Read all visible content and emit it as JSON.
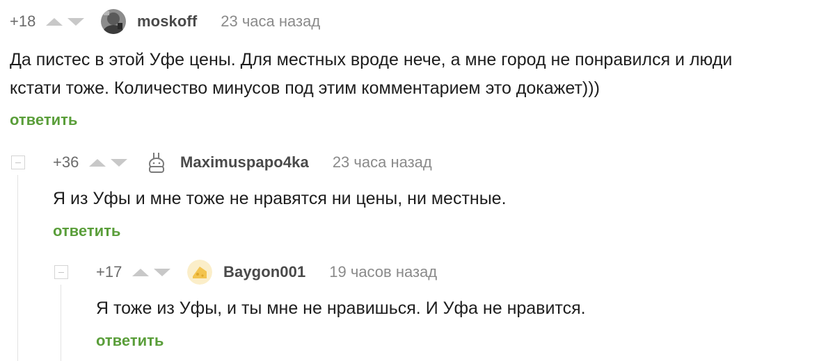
{
  "comments": [
    {
      "rating": "+18",
      "username": "moskoff",
      "time": "23 часа назад",
      "text_lines": [
        "Да пистес в этой Уфе цены. Для местных вроде нече, а мне город не понравился и люди",
        "кстати тоже. Количество минусов под этим комментарием это докажет)))"
      ],
      "reply_label": "ответить",
      "avatar_icon": "photo-avatar"
    },
    {
      "rating": "+36",
      "username": "Maximuspapo4ka",
      "time": "23 часа назад",
      "text_lines": [
        "Я из Уфы и мне тоже не нравятся ни цены, ни местные."
      ],
      "reply_label": "ответить",
      "avatar_icon": "bunny-icon"
    },
    {
      "rating": "+17",
      "username": "Baygon001",
      "time": "19 часов назад",
      "text_lines": [
        "Я тоже из Уфы, и ты мне не нравишься. И Уфа не нравится."
      ],
      "reply_label": "ответить",
      "avatar_icon": "cheese-icon"
    }
  ],
  "colors": {
    "reply": "#5a9e3a",
    "vote_arrow": "#c8c8c8",
    "meta": "#8a8a8a"
  }
}
